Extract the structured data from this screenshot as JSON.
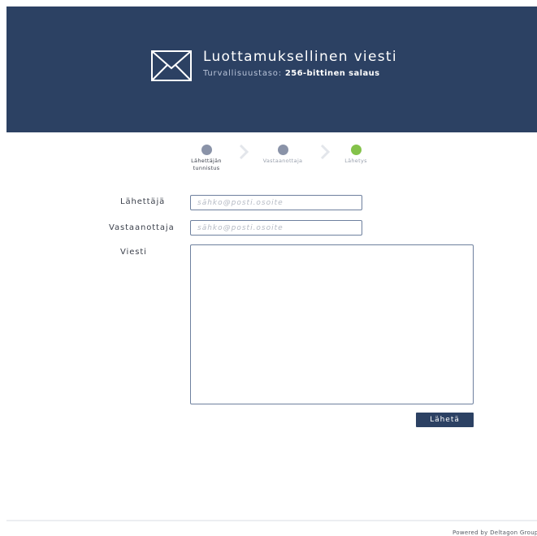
{
  "header": {
    "title": "Luottamuksellinen viesti",
    "security_label": "Turvallisuustaso:",
    "security_value": "256-bittinen salaus",
    "icon": "envelope-icon",
    "background_color": "#2c4163"
  },
  "steps": [
    {
      "label": "Lähettäjän tunnistus",
      "status": "done",
      "color": "#8a93a8"
    },
    {
      "label": "Vastaanottaja",
      "status": "done",
      "color": "#8a93a8"
    },
    {
      "label": "Lähetys",
      "status": "active",
      "color": "#84c24a"
    }
  ],
  "form": {
    "sender_label": "Lähettäjä",
    "sender_placeholder": "sähko@posti.osoite",
    "sender_value": "",
    "recipient_label": "Vastaanottaja",
    "recipient_placeholder": "sähko@posti.osoite",
    "recipient_value": "",
    "message_label": "Viesti",
    "message_value": "",
    "send_label": "Lähetä"
  },
  "footer": {
    "powered_by": "Powered by Deltagon Group"
  }
}
